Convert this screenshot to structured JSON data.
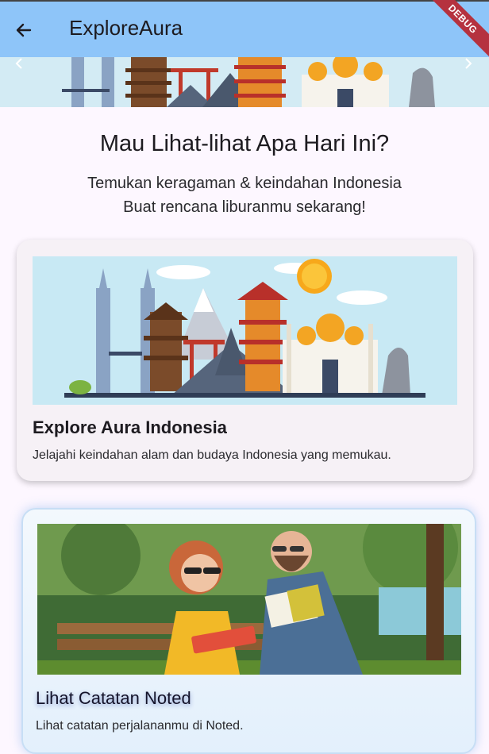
{
  "appbar": {
    "title": "ExploreAura",
    "back_icon": "arrow-left-icon",
    "debug_label": "DEBUG",
    "bg_color": "#8ec5f9"
  },
  "carousel": {
    "prev_icon": "chevron-left-icon",
    "next_icon": "chevron-right-icon"
  },
  "intro": {
    "heading": "Mau Lihat-lihat Apa Hari Ini?",
    "line1": "Temukan keragaman & keindahan Indonesia",
    "line2": "Buat rencana liburanmu sekarang!"
  },
  "cards": [
    {
      "title": "Explore Aura Indonesia",
      "description": "Jelajahi keindahan alam dan budaya Indonesia yang memukau."
    },
    {
      "title": "Lihat Catatan Noted",
      "description": "Lihat catatan perjalananmu di Noted."
    }
  ]
}
